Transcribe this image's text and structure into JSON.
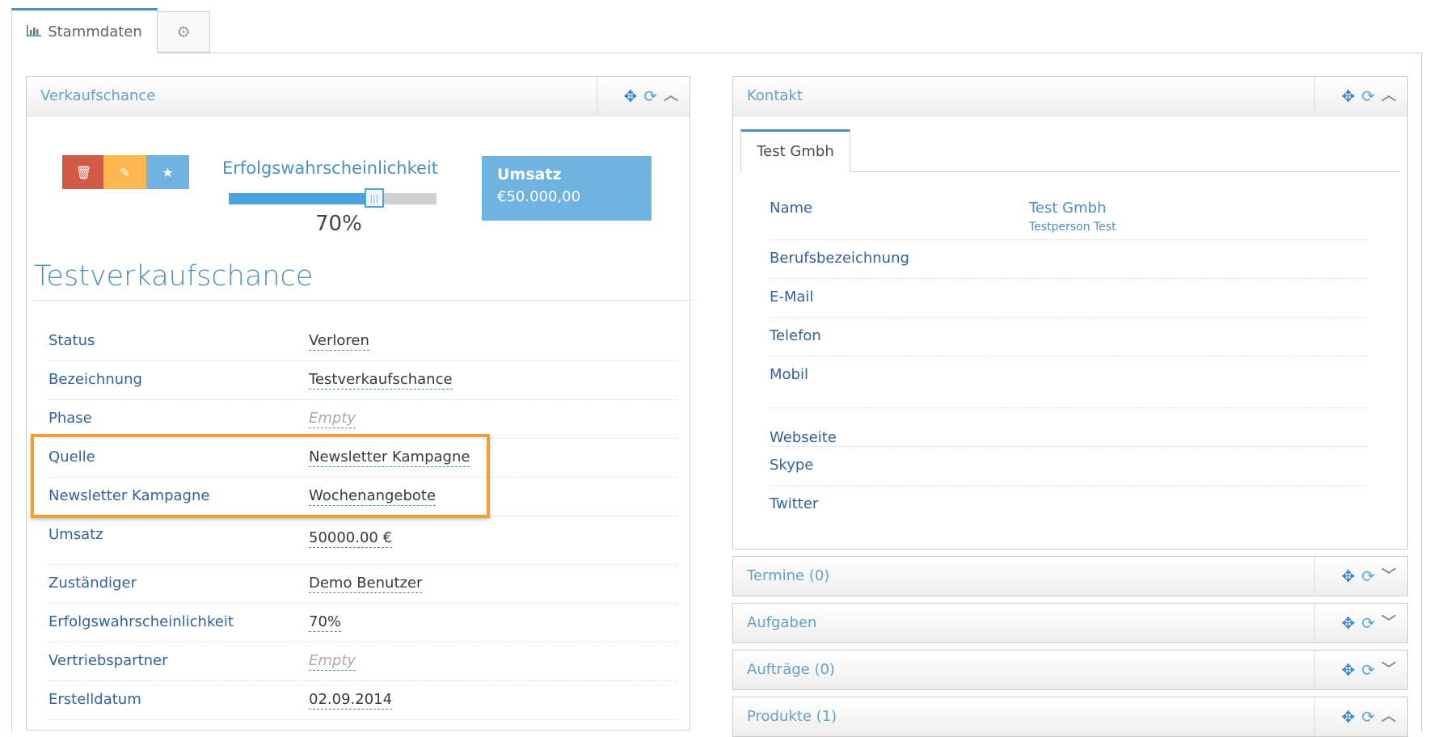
{
  "tabs": {
    "stammdaten_label": "Stammdaten",
    "stammdaten_icon": "bar-chart-icon",
    "settings_icon": "gear-icon"
  },
  "verkaufschance": {
    "title": "Verkaufschance",
    "buttons": {
      "delete_icon": "trash-icon",
      "edit_icon": "edit-icon",
      "favorite_icon": "star-icon",
      "delete_color": "#d15b47",
      "edit_color": "#ffb752",
      "favorite_color": "#6fb3e0"
    },
    "probability": {
      "label": "Erfolgswahrscheinlichkeit",
      "value_text": "70%",
      "value": 0.7
    },
    "umsatz_box": {
      "title": "Umsatz",
      "value": "€50.000,00"
    },
    "heading": "Testverkaufschance",
    "rows": [
      {
        "label": "Status",
        "value": "Verloren",
        "empty": false
      },
      {
        "label": "Bezeichnung",
        "value": "Testverkaufschance",
        "empty": false
      },
      {
        "label": "Phase",
        "value": "Empty",
        "empty": true
      },
      {
        "label": "Quelle",
        "value": "Newsletter Kampagne",
        "empty": false
      },
      {
        "label": "Newsletter Kampagne",
        "value": "Wochenangebote",
        "empty": false
      },
      {
        "label": "Umsatz",
        "value": "50000.00 €",
        "empty": false
      },
      {
        "label": "Zuständiger",
        "value": "Demo Benutzer",
        "empty": false
      },
      {
        "label": "Erfolgswahrscheinlichkeit",
        "value": "70%",
        "empty": false
      },
      {
        "label": "Vertriebspartner",
        "value": "Empty",
        "empty": true
      },
      {
        "label": "Erstelldatum",
        "value": "02.09.2014",
        "empty": false
      }
    ]
  },
  "kontakt": {
    "title": "Kontakt",
    "tab_label": "Test Gmbh",
    "rows": [
      {
        "label": "Name",
        "value": "Test Gmbh",
        "sub": "Testperson Test"
      },
      {
        "label": "Berufsbezeichnung",
        "value": ""
      },
      {
        "label": "E-Mail",
        "value": ""
      },
      {
        "label": "Telefon",
        "value": ""
      },
      {
        "label": "Mobil",
        "value": ""
      },
      {
        "label": "Webseite",
        "value": ""
      },
      {
        "label": "Skype",
        "value": ""
      },
      {
        "label": "Twitter",
        "value": ""
      }
    ]
  },
  "collapsed_widgets": [
    {
      "title": "Termine (0)",
      "state": "collapsed"
    },
    {
      "title": "Aufgaben",
      "state": "collapsed"
    },
    {
      "title": "Aufträge (0)",
      "state": "collapsed"
    },
    {
      "title": "Produkte (1)",
      "state": "expanded"
    }
  ],
  "toolbar_icons": {
    "move": "move-icon",
    "refresh": "refresh-icon",
    "collapse": "chevron-up-icon",
    "expand": "chevron-down-icon"
  },
  "colors": {
    "accent": "#4c8fbd",
    "highlight": "#f0a030",
    "label": "#336199"
  }
}
